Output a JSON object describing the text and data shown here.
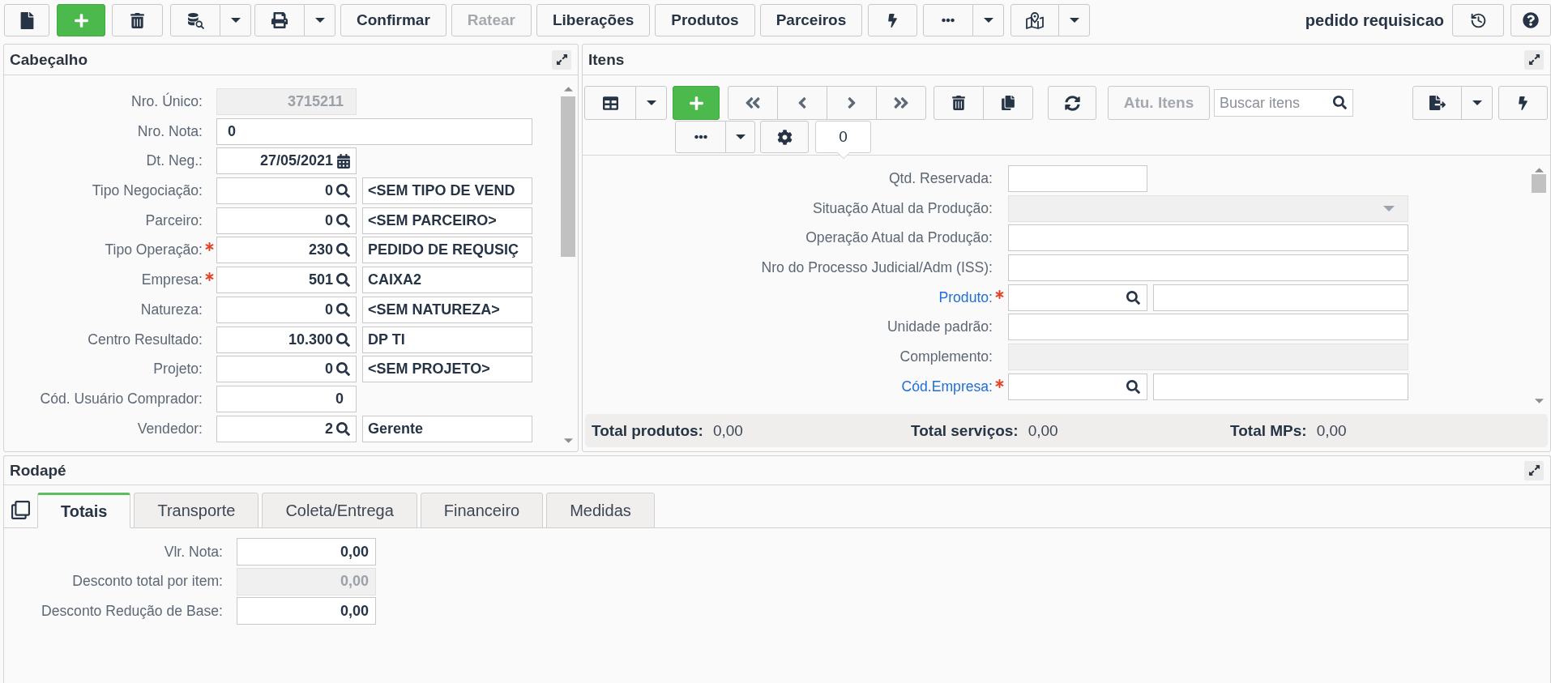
{
  "toolbar": {
    "buttons": [
      {
        "label": "Confirmar",
        "disabled": false
      },
      {
        "label": "Ratear",
        "disabled": true
      },
      {
        "label": "Liberações",
        "disabled": false
      },
      {
        "label": "Produtos",
        "disabled": false
      },
      {
        "label": "Parceiros",
        "disabled": false
      }
    ],
    "title": "pedido requisicao"
  },
  "header_panel": {
    "title": "Cabeçalho",
    "fields": [
      {
        "label": "Nro. Único:",
        "kind": "readonly",
        "required": false,
        "value": "3715211"
      },
      {
        "label": "Nro. Nota:",
        "kind": "text",
        "required": false,
        "value": "0"
      },
      {
        "label": "Dt. Neg.:",
        "kind": "date",
        "required": false,
        "value": "27/05/2021"
      },
      {
        "label": "Tipo Negociação:",
        "kind": "lookup",
        "required": false,
        "value": "0",
        "description": "<SEM TIPO DE VEND"
      },
      {
        "label": "Parceiro:",
        "kind": "lookup",
        "required": false,
        "value": "0",
        "description": "<SEM PARCEIRO>"
      },
      {
        "label": "Tipo Operação:",
        "kind": "lookup",
        "required": true,
        "value": "230",
        "description": "PEDIDO DE REQUSIÇ"
      },
      {
        "label": "Empresa:",
        "kind": "lookup",
        "required": true,
        "value": "501",
        "description": "CAIXA2"
      },
      {
        "label": "Natureza:",
        "kind": "lookup",
        "required": false,
        "value": "0",
        "description": "<SEM NATUREZA>"
      },
      {
        "label": "Centro Resultado:",
        "kind": "lookup",
        "required": false,
        "value": "10.300",
        "description": "DP TI"
      },
      {
        "label": "Projeto:",
        "kind": "lookup",
        "required": false,
        "value": "0",
        "description": "<SEM PROJETO>"
      },
      {
        "label": "Cód. Usuário Comprador:",
        "kind": "number",
        "required": false,
        "value": "0"
      },
      {
        "label": "Vendedor:",
        "kind": "lookup",
        "required": false,
        "value": "2",
        "description": "Gerente"
      }
    ]
  },
  "items_panel": {
    "title": "Itens",
    "toolbar": {
      "update_button": {
        "label": "Atu. Itens",
        "disabled": true
      },
      "search": {
        "placeholder": "Buscar itens"
      },
      "count": "0"
    },
    "fields": [
      {
        "label": "Qtd. Reservada:",
        "kind": "number",
        "required": false,
        "link": false,
        "disabled": false
      },
      {
        "label": "Situação Atual da Produção:",
        "kind": "select",
        "required": false,
        "link": false,
        "disabled": true
      },
      {
        "label": "Operação Atual da Produção:",
        "kind": "text",
        "required": false,
        "link": false,
        "disabled": false
      },
      {
        "label": "Nro do Processo Judicial/Adm (ISS):",
        "kind": "text",
        "required": false,
        "link": false,
        "disabled": false
      },
      {
        "label": "Produto:",
        "kind": "lookup",
        "required": true,
        "link": true,
        "disabled": false
      },
      {
        "label": "Unidade padrão:",
        "kind": "text",
        "required": false,
        "link": false,
        "disabled": false
      },
      {
        "label": "Complemento:",
        "kind": "text",
        "required": false,
        "link": false,
        "disabled": true
      },
      {
        "label": "Cód.Empresa:",
        "kind": "lookup",
        "required": true,
        "link": true,
        "disabled": false
      }
    ],
    "totals": [
      {
        "label": "Total produtos:",
        "value": "0,00"
      },
      {
        "label": "Total serviços:",
        "value": "0,00"
      },
      {
        "label": "Total MPs:",
        "value": "0,00"
      }
    ]
  },
  "footer_panel": {
    "title": "Rodapé",
    "tabs": [
      {
        "label": "Totais",
        "selected": true
      },
      {
        "label": "Transporte",
        "selected": false
      },
      {
        "label": "Coleta/Entrega",
        "selected": false
      },
      {
        "label": "Financeiro",
        "selected": false
      },
      {
        "label": "Medidas",
        "selected": false
      }
    ],
    "fields": [
      {
        "label": "Vlr. Nota:",
        "value": "0,00",
        "disabled": false
      },
      {
        "label": "Desconto total por item:",
        "value": "0,00",
        "disabled": true
      },
      {
        "label": "Desconto Redução de Base:",
        "value": "0,00",
        "disabled": false
      }
    ]
  }
}
